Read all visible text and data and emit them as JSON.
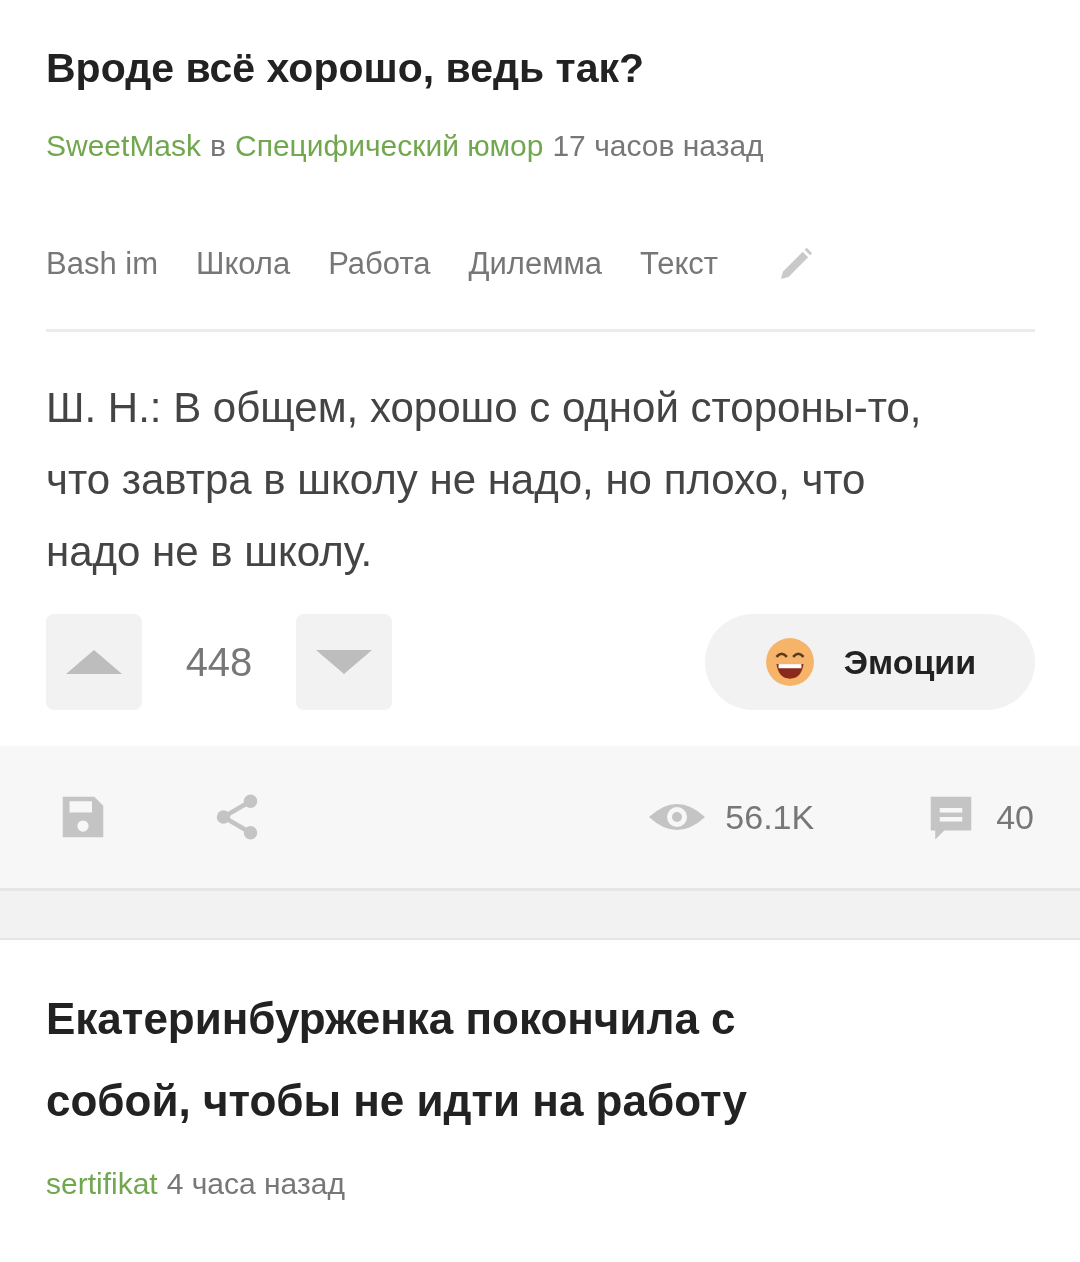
{
  "post": {
    "title": "Вроде всё хорошо, ведь так?",
    "author": "SweetMask",
    "preposition": "в",
    "community": "Специфический юмор",
    "time": "17 часов назад",
    "tags": [
      "Bash im",
      "Школа",
      "Работа",
      "Дилемма",
      "Текст"
    ],
    "body": "Ш. Н.: В общем, хорошо с одной стороны-то, что завтра в школу не надо, но плохо, что надо не в школу.",
    "rating": "448",
    "emotions": "Эмоции",
    "views": "56.1K",
    "comments": "40"
  },
  "next_post": {
    "title": "Екатеринбурженка покончила с собой, чтобы не идти на работу",
    "author": "sertifikat",
    "time": "4 часа назад"
  }
}
